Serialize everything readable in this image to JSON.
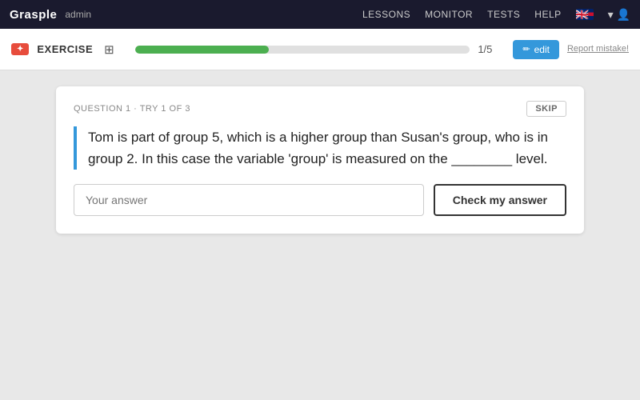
{
  "topnav": {
    "logo": "Grasple",
    "admin_label": "admin",
    "lessons": "LESSONS",
    "monitor": "MONITOR",
    "tests": "TESTS",
    "help": "HELP"
  },
  "exercise_bar": {
    "badge_label": "EXERCISE",
    "progress_fill_pct": "40",
    "progress_count": "1/5",
    "edit_label": "edit",
    "report_label": "Report mistake!"
  },
  "question": {
    "meta": "QUESTION 1 · TRY 1 OF 3",
    "skip_label": "SKIP",
    "text": "Tom is part of group 5, which is a higher group than Susan's group, who is in group 2. In this case the variable 'group' is measured on the ________ level.",
    "answer_placeholder": "Your answer",
    "check_label": "Check my answer"
  }
}
